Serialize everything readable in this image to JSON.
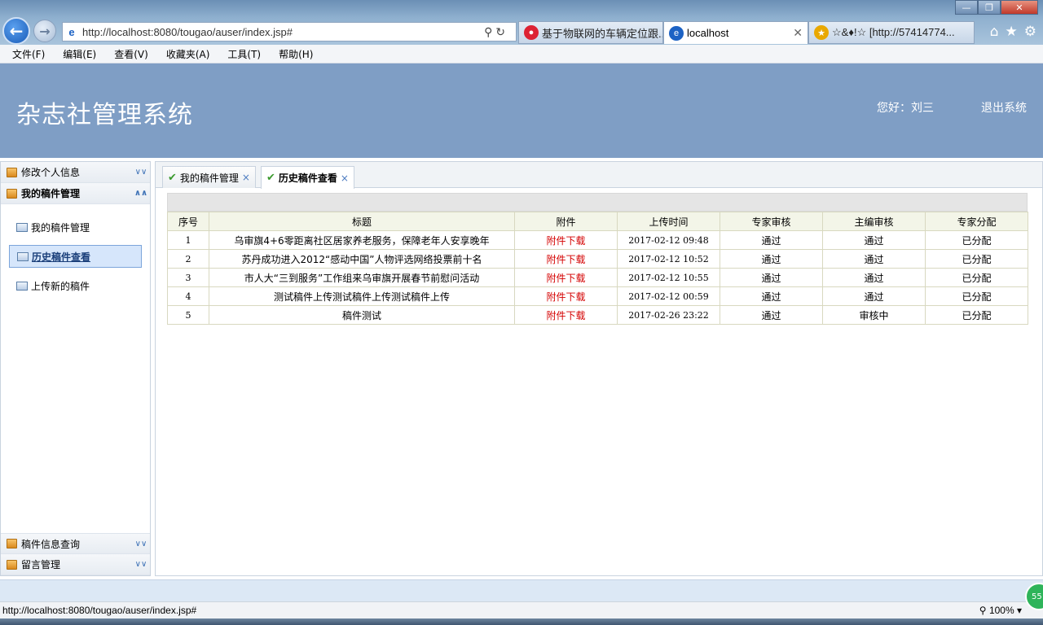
{
  "browser": {
    "url": "http://localhost:8080/tougao/auser/index.jsp#",
    "tabs": [
      {
        "label": "基于物联网的车辆定位跟...",
        "state": "inactive"
      },
      {
        "label": "localhost",
        "state": "active"
      },
      {
        "label": "☆&♦!☆ [http://57414774...",
        "state": "inactive"
      }
    ],
    "menu": [
      "文件(F)",
      "编辑(E)",
      "查看(V)",
      "收藏夹(A)",
      "工具(T)",
      "帮助(H)"
    ],
    "status_url": "http://localhost:8080/tougao/auser/index.jsp#",
    "zoom": "100%",
    "badge": "55"
  },
  "header": {
    "title": "杂志社管理系统",
    "greeting": "您好：刘三",
    "logout": "退出系统"
  },
  "sidebar": {
    "sections": [
      {
        "label": "修改个人信息",
        "expanded": false
      },
      {
        "label": "我的稿件管理",
        "expanded": true
      }
    ],
    "links": [
      {
        "label": "我的稿件管理",
        "selected": false
      },
      {
        "label": "历史稿件查看",
        "selected": true
      },
      {
        "label": "上传新的稿件",
        "selected": false
      }
    ],
    "bottom_sections": [
      {
        "label": "稿件信息查询"
      },
      {
        "label": "留言管理"
      }
    ]
  },
  "panel_tabs": [
    {
      "label": "我的稿件管理",
      "active": false
    },
    {
      "label": "历史稿件查看",
      "active": true
    }
  ],
  "table": {
    "columns": [
      "序号",
      "标题",
      "附件",
      "上传时间",
      "专家审核",
      "主编审核",
      "专家分配"
    ],
    "rows": [
      {
        "no": "1",
        "title": "乌审旗4+6零距离社区居家养老服务，保障老年人安享晚年",
        "attachment": "附件下载",
        "time": "2017-02-12 09:48",
        "expert": "通过",
        "editor": "通过",
        "assign": "已分配"
      },
      {
        "no": "2",
        "title": "苏丹成功进入2012“感动中国”人物评选网络投票前十名",
        "attachment": "附件下载",
        "time": "2017-02-12 10:52",
        "expert": "通过",
        "editor": "通过",
        "assign": "已分配"
      },
      {
        "no": "3",
        "title": "市人大“三到服务”工作组来乌审旗开展春节前慰问活动",
        "attachment": "附件下载",
        "time": "2017-02-12 10:55",
        "expert": "通过",
        "editor": "通过",
        "assign": "已分配"
      },
      {
        "no": "4",
        "title": "测试稿件上传测试稿件上传测试稿件上传",
        "attachment": "附件下载",
        "time": "2017-02-12 00:59",
        "expert": "通过",
        "editor": "通过",
        "assign": "已分配"
      },
      {
        "no": "5",
        "title": "稿件测试",
        "attachment": "附件下载",
        "time": "2017-02-26 23:22",
        "expert": "通过",
        "editor": "审核中",
        "assign": "已分配"
      }
    ]
  }
}
